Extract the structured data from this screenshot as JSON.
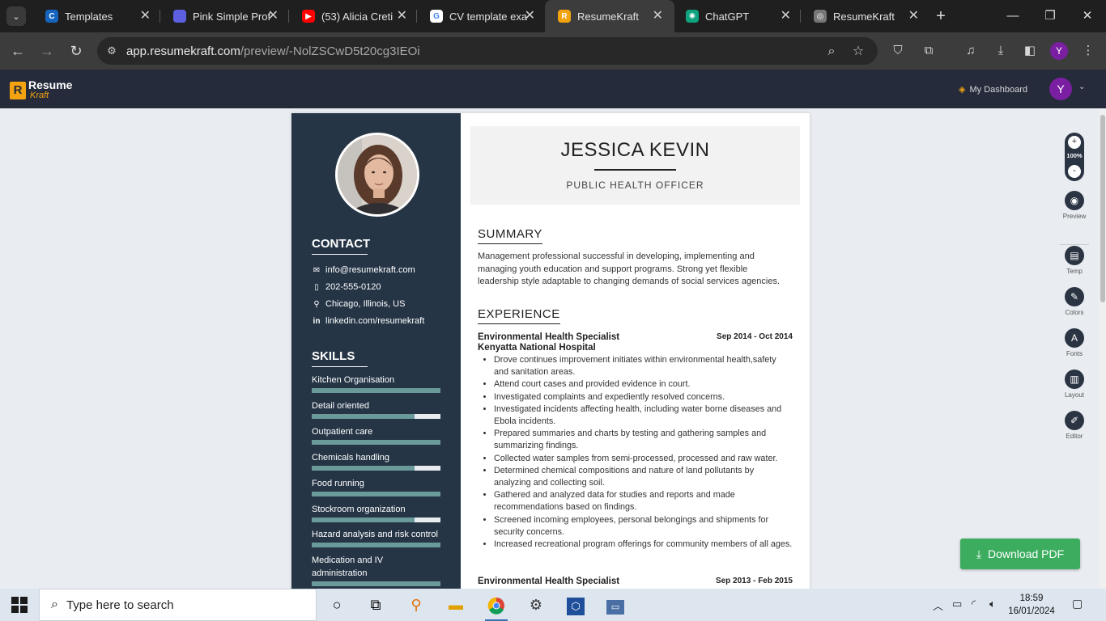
{
  "browser": {
    "tabs": [
      {
        "title": "Templates",
        "fav_color": "#1565c0",
        "fav_text": "C",
        "active": false
      },
      {
        "title": "Pink Simple Prof",
        "fav_color": "#5b5fe0",
        "fav_text": "",
        "active": false
      },
      {
        "title": "(53) Alicia Creti",
        "fav_color": "#ff0000",
        "fav_text": "▶",
        "active": false
      },
      {
        "title": "CV template exa",
        "fav_color": "#ffffff",
        "fav_text": "G",
        "active": false
      },
      {
        "title": "ResumeKraft",
        "fav_color": "#f2a30f",
        "fav_text": "R",
        "active": true
      },
      {
        "title": "ChatGPT",
        "fav_color": "#10a37f",
        "fav_text": "✺",
        "active": false
      },
      {
        "title": "ResumeKraft",
        "fav_color": "#777777",
        "fav_text": "◎",
        "active": false
      }
    ],
    "url_host": "app.resumekraft.com",
    "url_path": "/preview/-NolZSCwD5t20cg3IEOi",
    "profile_initial": "Y"
  },
  "app": {
    "logo_line1": "Resume",
    "logo_line2": "Kraft",
    "dashboard_label": "My Dashboard",
    "avatar_initial": "Y",
    "zoom": "100%",
    "zoom_in": "+",
    "zoom_out": "-",
    "tools": [
      {
        "label": "Preview",
        "icon": "eye-icon",
        "glyph": "◉"
      },
      {
        "label": "Temp",
        "icon": "template-icon",
        "glyph": "▤"
      },
      {
        "label": "Colors",
        "icon": "brush-icon",
        "glyph": "✎"
      },
      {
        "label": "Fonts",
        "icon": "font-icon",
        "glyph": "A"
      },
      {
        "label": "Layout",
        "icon": "layout-icon",
        "glyph": "▥"
      },
      {
        "label": "Editor",
        "icon": "pencil-icon",
        "glyph": "✐"
      }
    ],
    "download_label": "Download PDF",
    "download_color": "#3cad5f"
  },
  "resume": {
    "name": "JESSICA KEVIN",
    "title": "PUBLIC HEALTH OFFICER",
    "contact_heading": "CONTACT",
    "contact": [
      {
        "icon": "mail-icon",
        "glyph": "✉",
        "text": "info@resumekraft.com"
      },
      {
        "icon": "phone-icon",
        "glyph": "▯",
        "text": "202-555-0120"
      },
      {
        "icon": "location-icon",
        "glyph": "⚲",
        "text": "Chicago, Illinois, US"
      },
      {
        "icon": "linkedin-icon",
        "glyph": "in",
        "text": "linkedin.com/resumekraft"
      }
    ],
    "skills_heading": "SKILLS",
    "skills": [
      {
        "name": "Kitchen Organisation",
        "level": 1.0
      },
      {
        "name": "Detail oriented",
        "level": 0.8
      },
      {
        "name": "Outpatient care",
        "level": 1.0
      },
      {
        "name": "Chemicals handling",
        "level": 0.8
      },
      {
        "name": "Food running",
        "level": 1.0
      },
      {
        "name": "Stockroom organization",
        "level": 0.8
      },
      {
        "name": "Hazard analysis and risk control",
        "level": 1.0
      },
      {
        "name": "Medication and IV administration",
        "level": 1.0
      }
    ],
    "summary_heading": "SUMMARY",
    "summary": "Management professional successful in developing, implementing and managing youth education and support programs. Strong yet flexible leadership style adaptable to changing demands of social services agencies.",
    "experience_heading": "EXPERIENCE",
    "jobs": [
      {
        "role": "Environmental Health Specialist",
        "dates": "Sep 2014 - Oct 2014",
        "org": "Kenyatta National Hospital",
        "bullets": [
          "Drove continues improvement initiates within environmental health,safety and sanitation areas.",
          "Attend court cases and provided evidence in court.",
          "Investigated complaints and expediently resolved concerns.",
          "Investigated incidents affecting health, including water borne diseases and Ebola incidents.",
          "Prepared summaries and charts by testing and gathering samples and summarizing findings.",
          "Collected water samples from semi-processed, processed and raw water.",
          "Determined chemical compositions and nature of land pollutants by analyzing and collecting soil.",
          "Gathered and analyzed data for studies and reports and made recommendations based on findings.",
          "Screened incoming employees, personal belongings and shipments for security concerns.",
          "Increased recreational program offerings for community members of all ages."
        ]
      },
      {
        "role": "Environmental Health Specialist",
        "dates": "Sep 2013 - Feb 2015",
        "org": "",
        "bullets": []
      }
    ]
  },
  "taskbar": {
    "search_placeholder": "Type here to search",
    "time": "18:59",
    "date": "16/01/2024"
  }
}
